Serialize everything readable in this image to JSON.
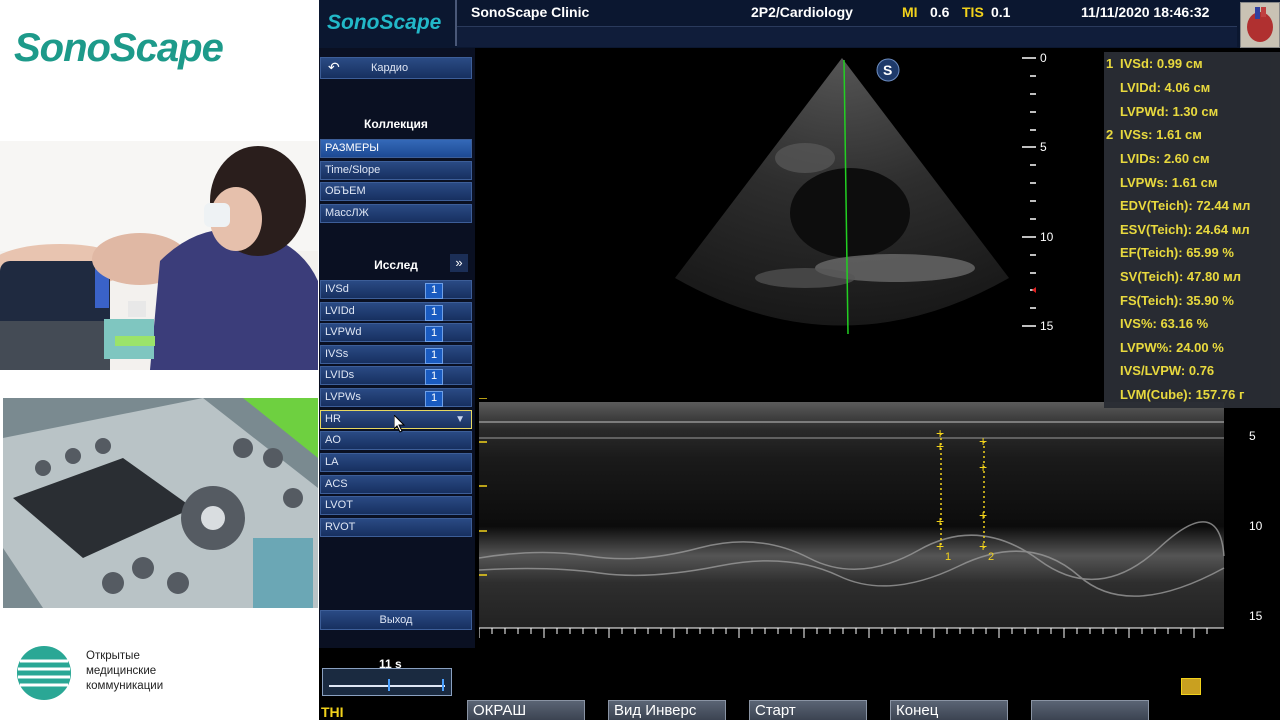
{
  "brand": {
    "name": "SonoScape"
  },
  "omk": {
    "line1": "Открытые",
    "line2": "медицинские",
    "line3": "коммуникации"
  },
  "topbar": {
    "logo": "SonoScape",
    "clinic": "SonoScape Clinic",
    "probe": "2P2/Cardiology",
    "mi_label": "MI",
    "mi_value": "0.6",
    "tis_label": "TIS",
    "tis_value": "0.1",
    "datetime": "11/11/2020 18:46:32"
  },
  "menu": {
    "back_label": "Кардио",
    "collection_title": "Коллекция",
    "collection_items": [
      "РАЗМЕРЫ",
      "Time/Slope",
      "ОБЪЕМ",
      "МассЛЖ"
    ],
    "study_title": "Исслед",
    "study_items": [
      {
        "label": "IVSd",
        "count": "1"
      },
      {
        "label": "LVIDd",
        "count": "1"
      },
      {
        "label": "LVPWd",
        "count": "1"
      },
      {
        "label": "IVSs",
        "count": "1"
      },
      {
        "label": "LVIDs",
        "count": "1"
      },
      {
        "label": "LVPWs",
        "count": "1"
      }
    ],
    "hr_label": "HR",
    "other_items": [
      "AO",
      "LA",
      "ACS",
      "LVOT",
      "RVOT"
    ],
    "exit_label": "Выход"
  },
  "depth_scale_top": [
    "0",
    "5",
    "10",
    "15"
  ],
  "depth_scale_mmode": [
    "5",
    "10",
    "15"
  ],
  "caliper_labels": [
    "1",
    "2"
  ],
  "measurements": {
    "group1_num": "1",
    "group2_num": "2",
    "rows": [
      "IVSd: 0.99   см",
      "LVIDd: 4.06   см",
      "LVPWd: 1.30   см",
      "IVSs: 1.61   см",
      "LVIDs: 2.60   см",
      "LVPWs: 1.61   см",
      "EDV(Teich): 72.44  мл",
      "ESV(Teich): 24.64  мл",
      "EF(Teich): 65.99  %",
      "SV(Teich): 47.80  мл",
      "FS(Teich): 35.90  %",
      "IVS%: 63.16  %",
      "LVPW%: 24.00  %",
      "IVS/LVPW: 0.76",
      "LVM(Cube): 157.76 г"
    ]
  },
  "bottom": {
    "time": "11 s",
    "thi": "THI",
    "buttons": [
      "ОКРАШ",
      "Вид Инверс",
      "Старт",
      "Конец"
    ]
  },
  "colors": {
    "accent_yellow": "#f2d21b",
    "brand_teal": "#1d9a8a",
    "menu_blue": "#173060"
  }
}
